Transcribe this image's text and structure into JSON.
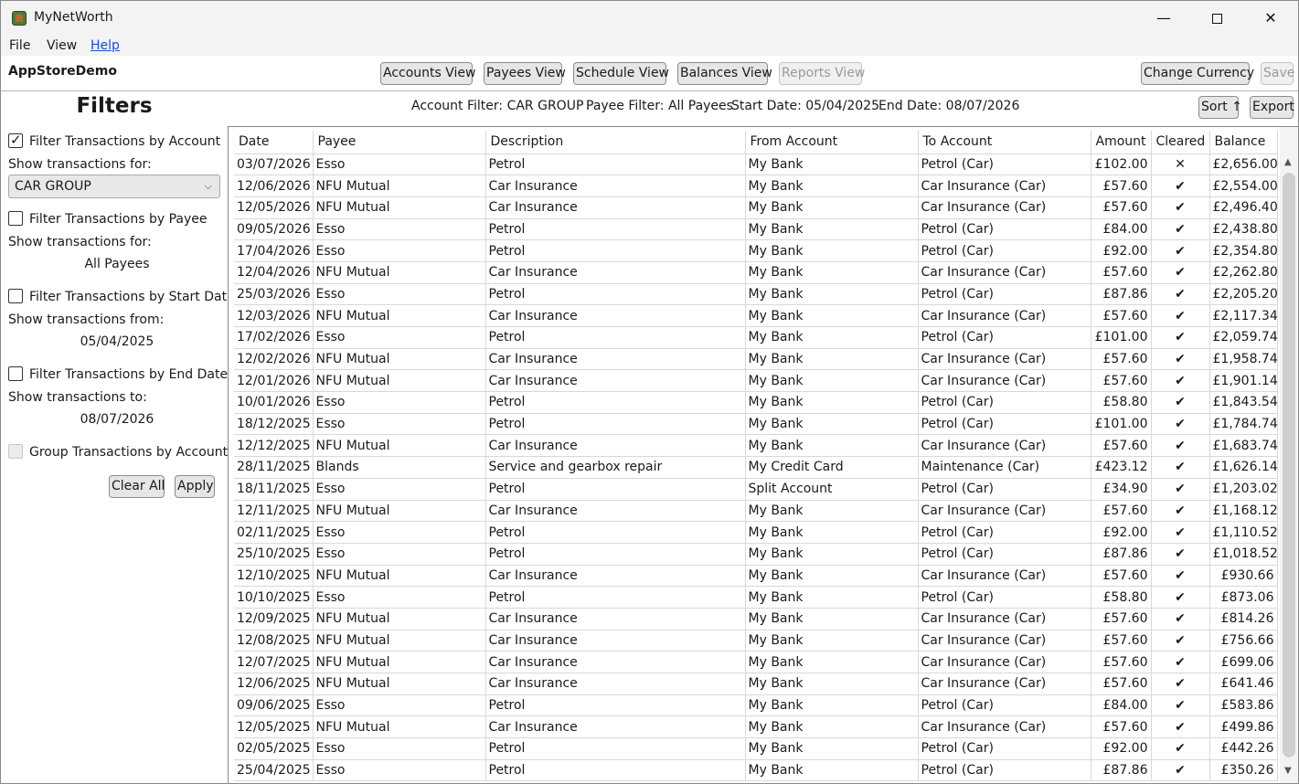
{
  "window": {
    "title": "MyNetWorth",
    "min_glyph": "—",
    "close_glyph": "✕"
  },
  "menu": {
    "file": "File",
    "view": "View",
    "help": "Help"
  },
  "toolbar": {
    "app_name": "AppStoreDemo",
    "accounts_view": "Accounts View",
    "payees_view": "Payees View",
    "schedule_view": "Schedule View",
    "balances_view": "Balances View",
    "reports_view": "Reports View",
    "change_currency": "Change Currency",
    "save": "Save"
  },
  "filter_summary": {
    "account": "Account Filter: CAR GROUP",
    "payee": "Payee Filter: All Payees",
    "start": "Start Date: 05/04/2025",
    "end": "End Date: 08/07/2026",
    "sort": "Sort ↑",
    "export": "Export"
  },
  "filters": {
    "title": "Filters",
    "by_account_label": "Filter Transactions by Account",
    "by_account_checked": true,
    "show_for_label": "Show transactions for:",
    "account_selected": "CAR GROUP",
    "by_payee_label": "Filter Transactions by Payee",
    "payee_show_for_label": "Show transactions for:",
    "payee_value": "All Payees",
    "by_start_label": "Filter Transactions by Start Date",
    "show_from_label": "Show transactions from:",
    "start_value": "05/04/2025",
    "by_end_label": "Filter Transactions by End Date",
    "show_to_label": "Show transactions to:",
    "end_value": "08/07/2026",
    "group_label": "Group Transactions by Account",
    "clear_all": "Clear All",
    "apply": "Apply"
  },
  "grid": {
    "columns": [
      "Date",
      "Payee",
      "Description",
      "From Account",
      "To Account",
      "Amount",
      "Cleared",
      "Balance"
    ],
    "rows": [
      [
        "03/07/2026",
        "Esso",
        "Petrol",
        "My Bank",
        "Petrol (Car)",
        "£102.00",
        "✕",
        "£2,656.00"
      ],
      [
        "12/06/2026",
        "NFU Mutual",
        "Car Insurance",
        "My Bank",
        "Car Insurance (Car)",
        "£57.60",
        "✔",
        "£2,554.00"
      ],
      [
        "12/05/2026",
        "NFU Mutual",
        "Car Insurance",
        "My Bank",
        "Car Insurance (Car)",
        "£57.60",
        "✔",
        "£2,496.40"
      ],
      [
        "09/05/2026",
        "Esso",
        "Petrol",
        "My Bank",
        "Petrol (Car)",
        "£84.00",
        "✔",
        "£2,438.80"
      ],
      [
        "17/04/2026",
        "Esso",
        "Petrol",
        "My Bank",
        "Petrol (Car)",
        "£92.00",
        "✔",
        "£2,354.80"
      ],
      [
        "12/04/2026",
        "NFU Mutual",
        "Car Insurance",
        "My Bank",
        "Car Insurance (Car)",
        "£57.60",
        "✔",
        "£2,262.80"
      ],
      [
        "25/03/2026",
        "Esso",
        "Petrol",
        "My Bank",
        "Petrol (Car)",
        "£87.86",
        "✔",
        "£2,205.20"
      ],
      [
        "12/03/2026",
        "NFU Mutual",
        "Car Insurance",
        "My Bank",
        "Car Insurance (Car)",
        "£57.60",
        "✔",
        "£2,117.34"
      ],
      [
        "17/02/2026",
        "Esso",
        "Petrol",
        "My Bank",
        "Petrol (Car)",
        "£101.00",
        "✔",
        "£2,059.74"
      ],
      [
        "12/02/2026",
        "NFU Mutual",
        "Car Insurance",
        "My Bank",
        "Car Insurance (Car)",
        "£57.60",
        "✔",
        "£1,958.74"
      ],
      [
        "12/01/2026",
        "NFU Mutual",
        "Car Insurance",
        "My Bank",
        "Car Insurance (Car)",
        "£57.60",
        "✔",
        "£1,901.14"
      ],
      [
        "10/01/2026",
        "Esso",
        "Petrol",
        "My Bank",
        "Petrol (Car)",
        "£58.80",
        "✔",
        "£1,843.54"
      ],
      [
        "18/12/2025",
        "Esso",
        "Petrol",
        "My Bank",
        "Petrol (Car)",
        "£101.00",
        "✔",
        "£1,784.74"
      ],
      [
        "12/12/2025",
        "NFU Mutual",
        "Car Insurance",
        "My Bank",
        "Car Insurance (Car)",
        "£57.60",
        "✔",
        "£1,683.74"
      ],
      [
        "28/11/2025",
        "Blands",
        "Service and gearbox repair",
        "My Credit Card",
        "Maintenance (Car)",
        "£423.12",
        "✔",
        "£1,626.14"
      ],
      [
        "18/11/2025",
        "Esso",
        "Petrol",
        "Split Account",
        "Petrol (Car)",
        "£34.90",
        "✔",
        "£1,203.02"
      ],
      [
        "12/11/2025",
        "NFU Mutual",
        "Car Insurance",
        "My Bank",
        "Car Insurance (Car)",
        "£57.60",
        "✔",
        "£1,168.12"
      ],
      [
        "02/11/2025",
        "Esso",
        "Petrol",
        "My Bank",
        "Petrol (Car)",
        "£92.00",
        "✔",
        "£1,110.52"
      ],
      [
        "25/10/2025",
        "Esso",
        "Petrol",
        "My Bank",
        "Petrol (Car)",
        "£87.86",
        "✔",
        "£1,018.52"
      ],
      [
        "12/10/2025",
        "NFU Mutual",
        "Car Insurance",
        "My Bank",
        "Car Insurance (Car)",
        "£57.60",
        "✔",
        "£930.66"
      ],
      [
        "10/10/2025",
        "Esso",
        "Petrol",
        "My Bank",
        "Petrol (Car)",
        "£58.80",
        "✔",
        "£873.06"
      ],
      [
        "12/09/2025",
        "NFU Mutual",
        "Car Insurance",
        "My Bank",
        "Car Insurance (Car)",
        "£57.60",
        "✔",
        "£814.26"
      ],
      [
        "12/08/2025",
        "NFU Mutual",
        "Car Insurance",
        "My Bank",
        "Car Insurance (Car)",
        "£57.60",
        "✔",
        "£756.66"
      ],
      [
        "12/07/2025",
        "NFU Mutual",
        "Car Insurance",
        "My Bank",
        "Car Insurance (Car)",
        "£57.60",
        "✔",
        "£699.06"
      ],
      [
        "12/06/2025",
        "NFU Mutual",
        "Car Insurance",
        "My Bank",
        "Car Insurance (Car)",
        "£57.60",
        "✔",
        "£641.46"
      ],
      [
        "09/06/2025",
        "Esso",
        "Petrol",
        "My Bank",
        "Petrol (Car)",
        "£84.00",
        "✔",
        "£583.86"
      ],
      [
        "12/05/2025",
        "NFU Mutual",
        "Car Insurance",
        "My Bank",
        "Car Insurance (Car)",
        "£57.60",
        "✔",
        "£499.86"
      ],
      [
        "02/05/2025",
        "Esso",
        "Petrol",
        "My Bank",
        "Petrol (Car)",
        "£92.00",
        "✔",
        "£442.26"
      ],
      [
        "25/04/2025",
        "Esso",
        "Petrol",
        "My Bank",
        "Petrol (Car)",
        "£87.86",
        "✔",
        "£350.26"
      ]
    ]
  },
  "colors": {
    "accent_link": "#1a4fd0",
    "title_bg": "#f3f3f3"
  }
}
